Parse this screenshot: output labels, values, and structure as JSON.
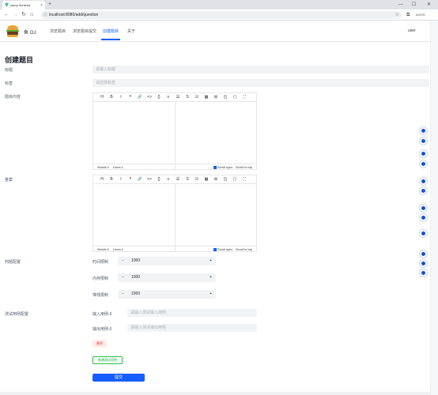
{
  "browser": {
    "tab_title": "yacoj-frontend",
    "tab_close": "×",
    "new_tab": "+",
    "url": "localhost:8080/add/question",
    "edge_label": "AGOS",
    "min": "—",
    "max": "☐",
    "close": "✕"
  },
  "header": {
    "brand": "鱼 OJ",
    "nav": [
      "浏览题目",
      "浏览题目提交",
      "创建题目",
      "关于"
    ],
    "user": "user"
  },
  "page": {
    "title": "创建题目",
    "title_label": "标题",
    "title_placeholder": "请输入标题",
    "tags_label": "标签",
    "tags_placeholder": "请选择标签",
    "content_label": "题目内容",
    "answer_label": "答案",
    "config_label": "判题配置",
    "cases_label": "测试用例配置"
  },
  "editor": {
    "toolbar": [
      "H",
      "B",
      "I",
      "❝",
      "🔗",
      "<>",
      "{}",
      "≡",
      "☰",
      "S",
      "☑",
      "▦",
      "⊞",
      "◫",
      "▢",
      "⛶"
    ],
    "words": "Words 0",
    "lines": "Lines 1",
    "sync": "Scroll sync",
    "stt": "Scroll to top"
  },
  "judge": [
    {
      "label": "时间限制",
      "value": "1000"
    },
    {
      "label": "内存限制",
      "value": "1000"
    },
    {
      "label": "堆栈限制",
      "value": "1000"
    }
  ],
  "stepper": {
    "minus": "−",
    "plus": "+"
  },
  "cases": {
    "input_label": "输入用例-0",
    "input_placeholder": "请输入测试输入用例",
    "output_label": "输出用例-0",
    "output_placeholder": "请输入测试输出用例",
    "delete": "删除",
    "add": "新增测试用例",
    "submit": "提交"
  }
}
